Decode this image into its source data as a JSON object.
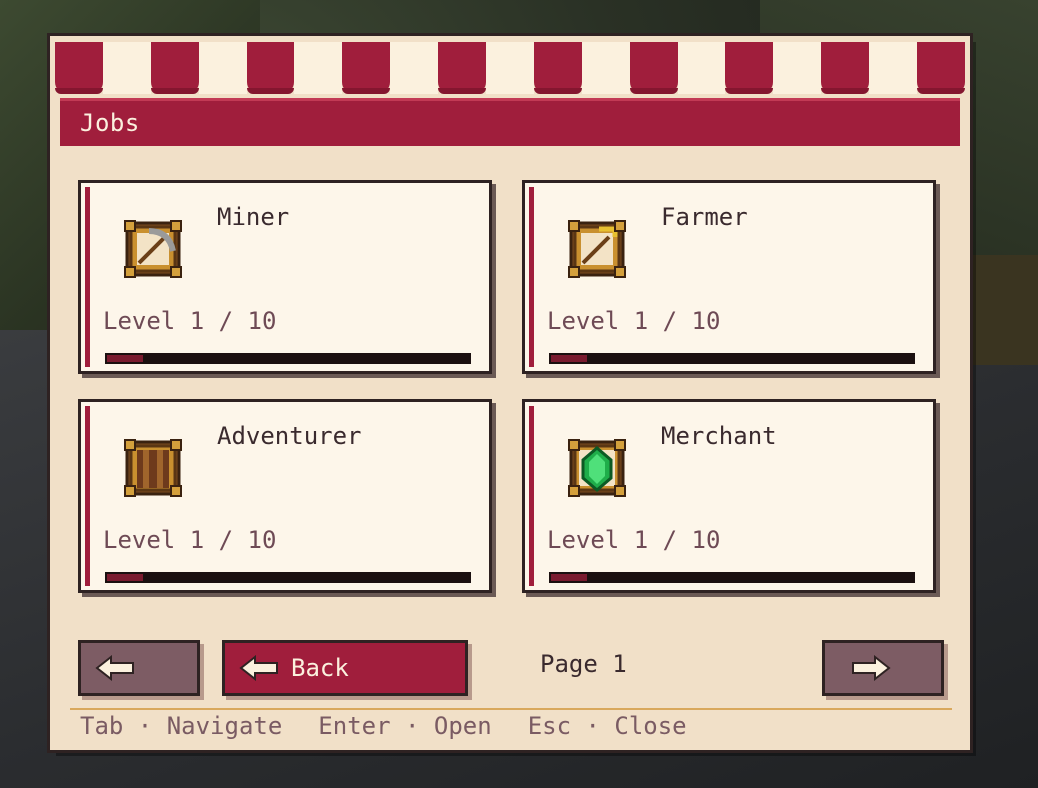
{
  "window": {
    "title": "Jobs"
  },
  "jobs": [
    {
      "name": "Miner",
      "icon": "pickaxe-icon",
      "level": "Level 1 / 10",
      "progress": 0.1
    },
    {
      "name": "Farmer",
      "icon": "hoe-icon",
      "level": "Level 1 / 10",
      "progress": 0.1
    },
    {
      "name": "Adventurer",
      "icon": "book-icon",
      "level": "Level 1 / 10",
      "progress": 0.1
    },
    {
      "name": "Merchant",
      "icon": "emerald-icon",
      "level": "Level 1 / 10",
      "progress": 0.1
    }
  ],
  "nav": {
    "prev_icon": "arrow-left-icon",
    "back_label": "Back",
    "back_icon": "arrow-left-icon",
    "page_label": "Page 1",
    "next_icon": "arrow-right-icon"
  },
  "hints": [
    "Tab · Navigate",
    "Enter · Open",
    "Esc · Close"
  ],
  "colors": {
    "accent": "#a01e3c",
    "panel": "#f1e0c8",
    "card": "#fdf6ea",
    "progress": "#7a1b2f"
  }
}
